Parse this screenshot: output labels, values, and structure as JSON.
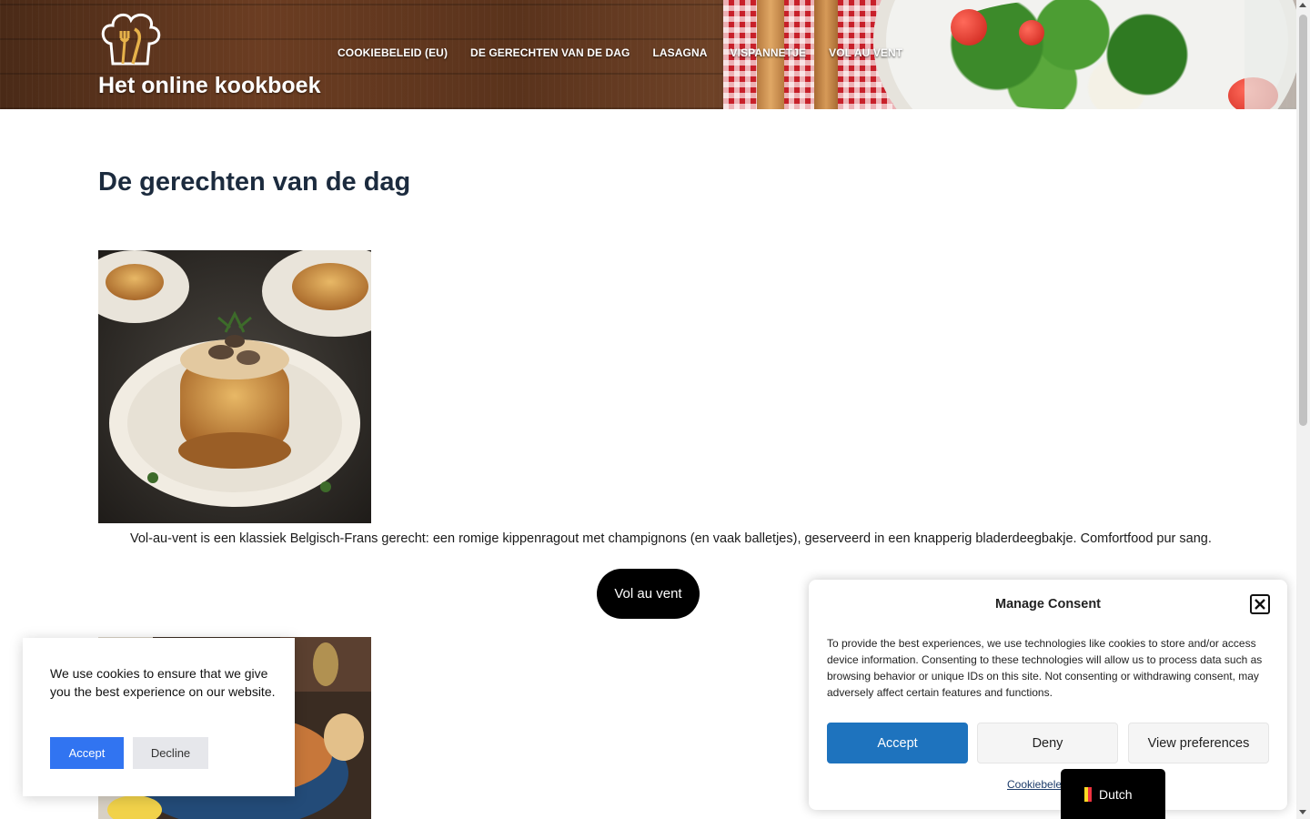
{
  "site": {
    "title": "Het online kookboek"
  },
  "nav": {
    "items": [
      {
        "label": "Cookiebeleid (EU)"
      },
      {
        "label": "De gerechten van de dag"
      },
      {
        "label": "Lasagna"
      },
      {
        "label": "Vispannetje"
      },
      {
        "label": "Vol au vent"
      }
    ]
  },
  "main": {
    "heading": "De gerechten van de dag",
    "dishes": [
      {
        "description": "Vol-au-vent is een klassiek Belgisch-Frans gerecht: een romige kippenragout met champignons (en vaak balletjes), geserveerd in een knapperig bladerdeegbakje. Comfortfood pur sang.",
        "button": "Vol au vent"
      }
    ]
  },
  "cookie_banner": {
    "message": "We use cookies to ensure that we give you the best experience on our website.",
    "accept": "Accept",
    "decline": "Decline"
  },
  "consent": {
    "title": "Manage Consent",
    "body": "To provide the best experiences, we use technologies like cookies to store and/or access device information. Consenting to these technologies will allow us to process data such as browsing behavior or unique IDs on this site. Not consenting or withdrawing consent, may adversely affect certain features and functions.",
    "accept": "Accept",
    "deny": "Deny",
    "view_preferences": "View preferences",
    "policy_link": "Cookiebeleid (EU)"
  },
  "language": {
    "label": "Dutch"
  },
  "colors": {
    "accent": "#1e73be",
    "heading": "#1c2b3e",
    "cookie_accept": "#3174f1"
  },
  "icons": {
    "logo": "chef-hat-icon",
    "close": "close-icon",
    "flag": "belgium-flag-icon"
  }
}
